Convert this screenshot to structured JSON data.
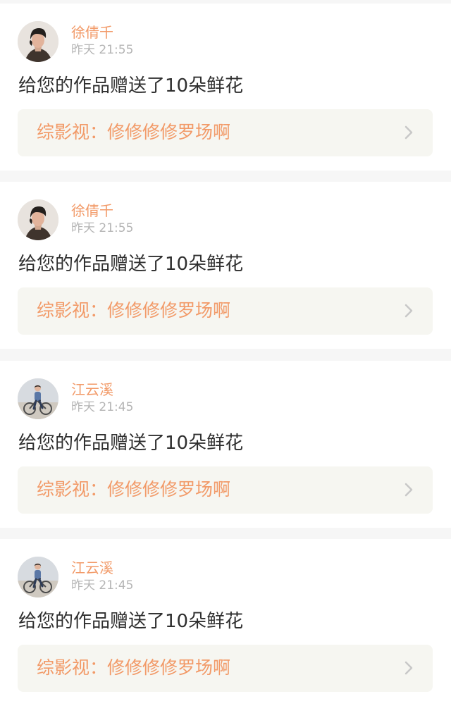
{
  "notifications": [
    {
      "user_name": "徐倩千",
      "timestamp": "昨天 21:55",
      "message": "给您的作品赠送了10朵鲜花",
      "work_label": "综影视：修修修修罗场啊",
      "avatar_icon": "portrait-avatar-icon"
    },
    {
      "user_name": "徐倩千",
      "timestamp": "昨天 21:55",
      "message": "给您的作品赠送了10朵鲜花",
      "work_label": "综影视：修修修修罗场啊",
      "avatar_icon": "portrait-avatar-icon"
    },
    {
      "user_name": "江云溪",
      "timestamp": "昨天 21:45",
      "message": "给您的作品赠送了10朵鲜花",
      "work_label": "综影视：修修修修罗场啊",
      "avatar_icon": "bicycle-avatar-icon"
    },
    {
      "user_name": "江云溪",
      "timestamp": "昨天 21:45",
      "message": "给您的作品赠送了10朵鲜花",
      "work_label": "综影视：修修修修罗场啊",
      "avatar_icon": "bicycle-avatar-icon"
    }
  ],
  "colors": {
    "accent": "#f29a68",
    "time": "#b5b5b5",
    "message": "#2f2f2f",
    "row_background": "#f6f6f1",
    "page_background": "#f6f6f6",
    "chevron": "#c8c8c8"
  }
}
